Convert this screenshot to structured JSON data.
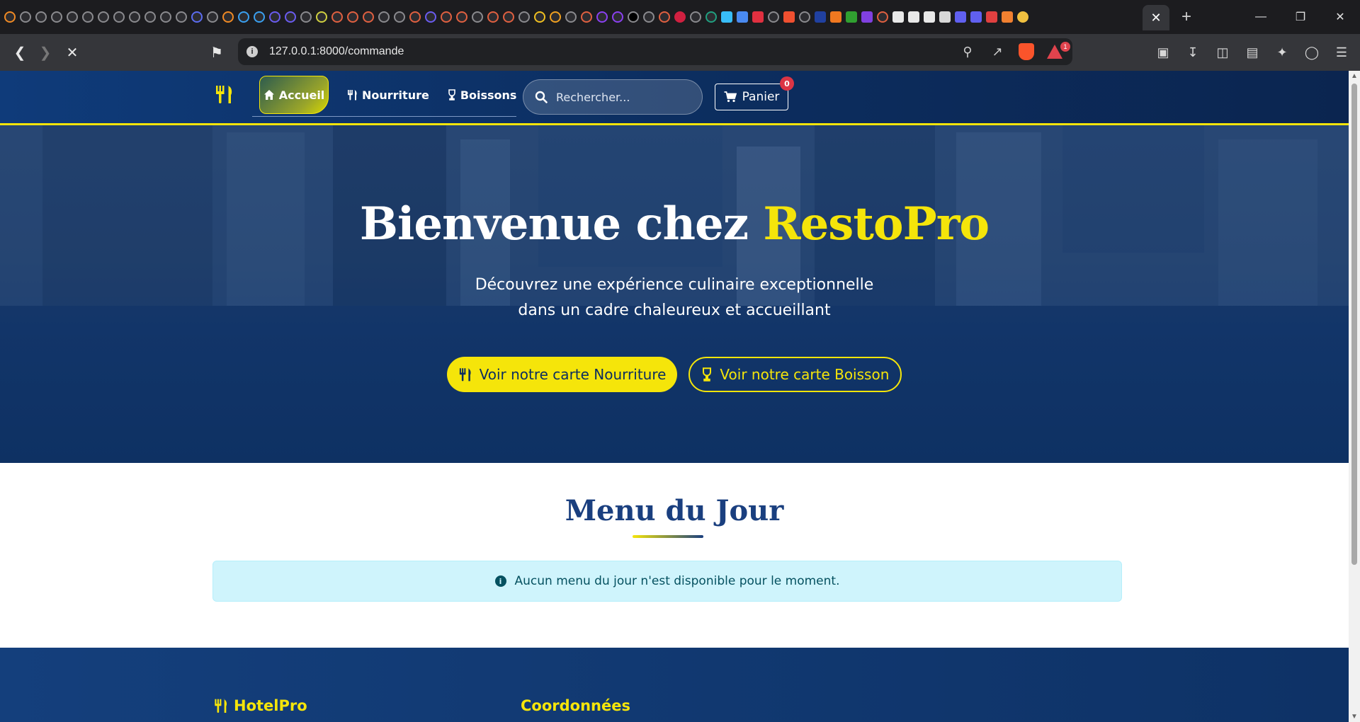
{
  "browser": {
    "url": "127.0.0.1:8000/commande",
    "tab_close": "✕",
    "new_tab": "+",
    "brave_badge": "1"
  },
  "nav": {
    "home_label": "Accueil",
    "food_label": "Nourriture",
    "drinks_label": "Boissons",
    "search_placeholder": "Rechercher...",
    "cart_label": "Panier",
    "cart_count": "0"
  },
  "hero": {
    "title_prefix": "Bienvenue chez ",
    "title_highlight": "RestoPro",
    "subtitle_line1": "Découvrez une expérience culinaire exceptionnelle",
    "subtitle_line2": "dans un cadre chaleureux et accueillant",
    "btn_food": "Voir notre carte Nourriture",
    "btn_drinks": "Voir notre carte Boisson"
  },
  "menu": {
    "title": "Menu du Jour",
    "empty_message": "Aucun menu du jour n'est disponible pour le moment."
  },
  "footer": {
    "brand": "HotelPro",
    "coordinates_title": "Coordonnées"
  },
  "colors": {
    "accent": "#f5e50a",
    "navy": "#0c2e60",
    "info_bg": "#cff4fc"
  }
}
